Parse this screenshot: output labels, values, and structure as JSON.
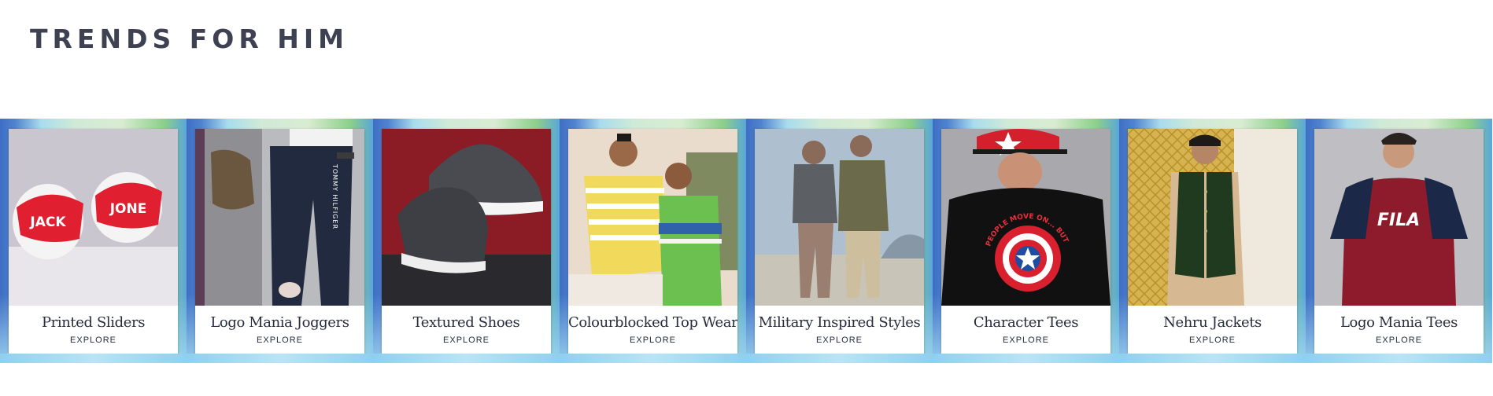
{
  "section": {
    "title": "TRENDS FOR HIM"
  },
  "cards": [
    {
      "name": "Printed Sliders",
      "cta": "EXPLORE",
      "image_desc_icon": "slider-icon"
    },
    {
      "name": "Logo Mania Joggers",
      "cta": "EXPLORE",
      "image_desc_icon": "joggers-icon"
    },
    {
      "name": "Textured Shoes",
      "cta": "EXPLORE",
      "image_desc_icon": "shoe-icon"
    },
    {
      "name": "Colourblocked Top Wear",
      "cta": "EXPLORE",
      "image_desc_icon": "tshirt-icon"
    },
    {
      "name": "Military Inspired Styles",
      "cta": "EXPLORE",
      "image_desc_icon": "jacket-icon"
    },
    {
      "name": "Character Tees",
      "cta": "EXPLORE",
      "image_desc_icon": "tshirt-icon"
    },
    {
      "name": "Nehru Jackets",
      "cta": "EXPLORE",
      "image_desc_icon": "vest-icon"
    },
    {
      "name": "Logo Mania Tees",
      "cta": "EXPLORE",
      "image_desc_icon": "tshirt-icon"
    }
  ],
  "image_text": {
    "slider_left": "JACK",
    "slider_right": "JONE",
    "jogger_brand": "TOMMY HILFIGER",
    "tee_brand": "FILA",
    "tee_print": "PEOPLE MOVE ON... BUT NOT ME"
  }
}
